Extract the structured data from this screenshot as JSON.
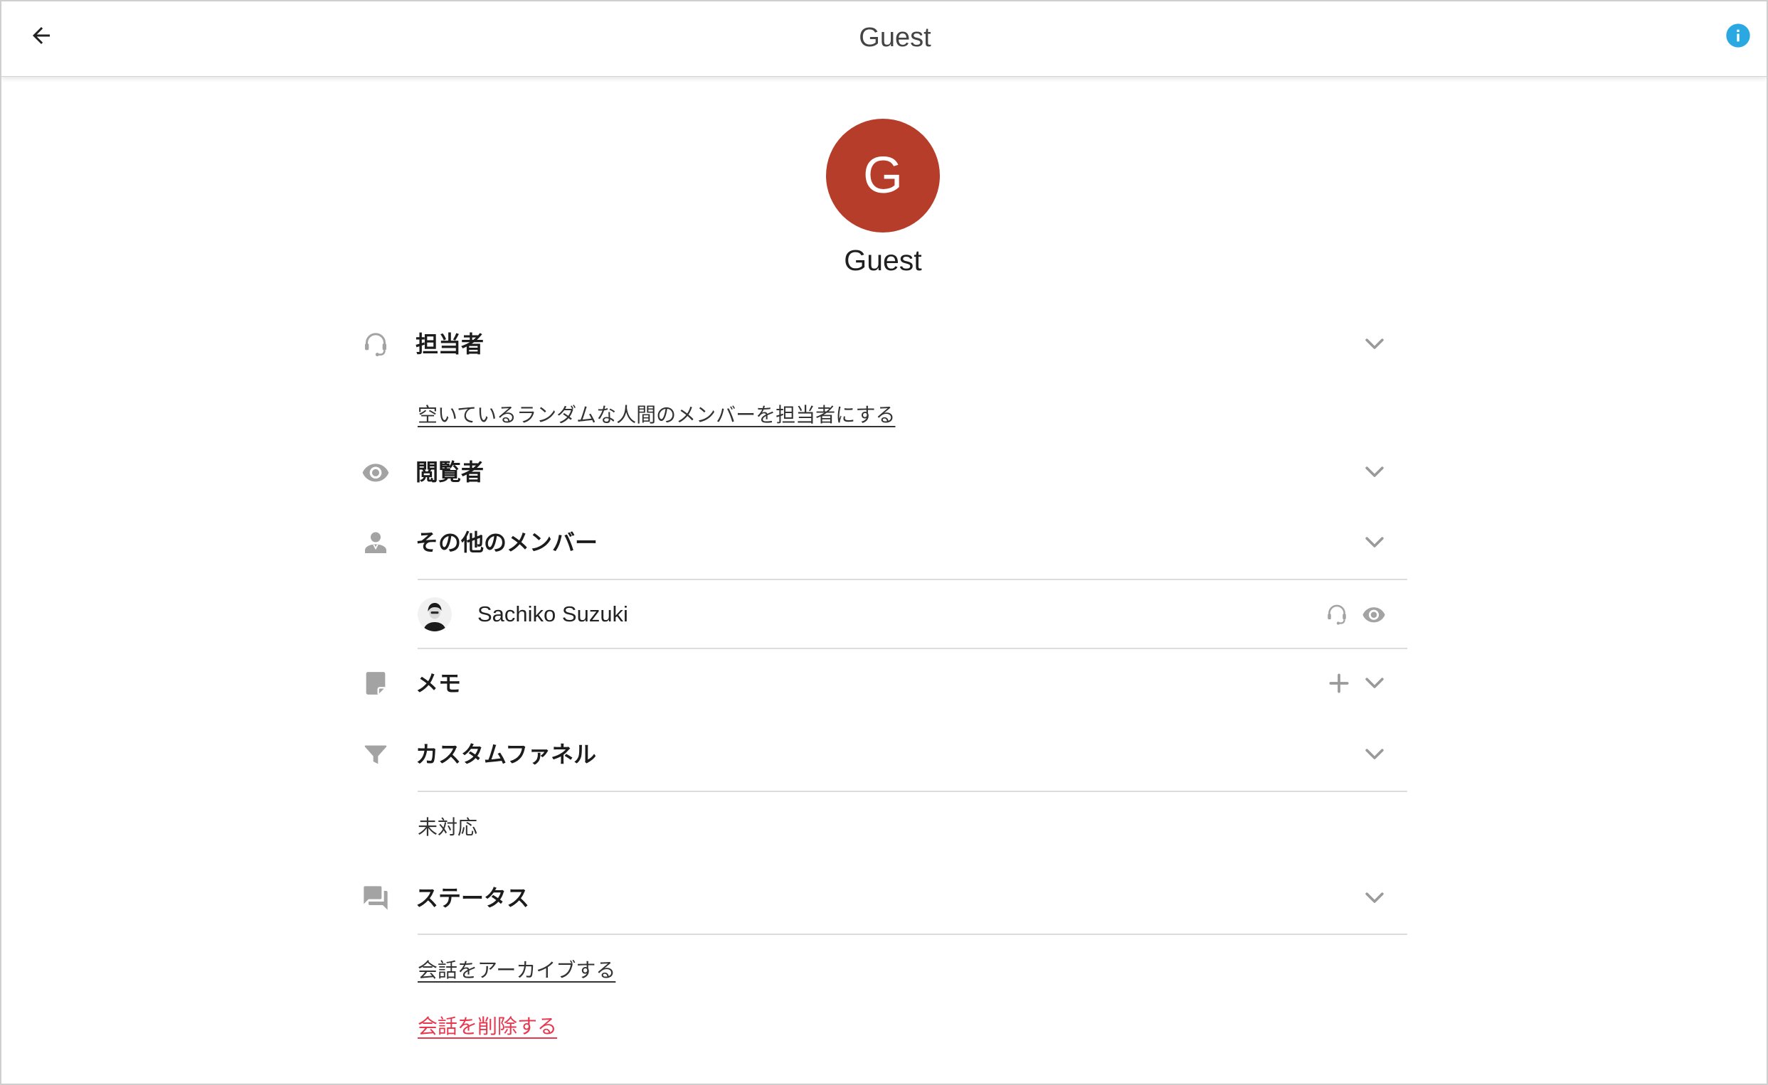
{
  "header": {
    "title": "Guest",
    "back_icon": "arrow-back-icon",
    "info_icon": "info-icon"
  },
  "profile": {
    "avatar_letter": "G",
    "avatar_color": "#b53d2a",
    "name": "Guest"
  },
  "sections": {
    "assignee": {
      "label": "担当者",
      "icon": "headset-icon",
      "action_link": "空いているランダムな人間のメンバーを担当者にする"
    },
    "viewers": {
      "label": "閲覧者",
      "icon": "eye-icon"
    },
    "other_members": {
      "label": "その他のメンバー",
      "icon": "person-icon",
      "members": [
        {
          "name": "Sachiko Suzuki",
          "actions": [
            "headset-icon",
            "eye-icon"
          ]
        }
      ]
    },
    "memo": {
      "label": "メモ",
      "icon": "note-icon",
      "add_icon": "plus-icon"
    },
    "custom_funnel": {
      "label": "カスタムファネル",
      "icon": "filter-icon",
      "value": "未対応"
    },
    "status": {
      "label": "ステータス",
      "icon": "forum-icon",
      "archive_link": "会話をアーカイブする",
      "delete_link": "会話を削除する"
    }
  },
  "colors": {
    "info_accent": "#2aa8e2",
    "danger": "#e8384f",
    "icon_gray": "#a3a3a3",
    "avatar": "#b53d2a"
  }
}
